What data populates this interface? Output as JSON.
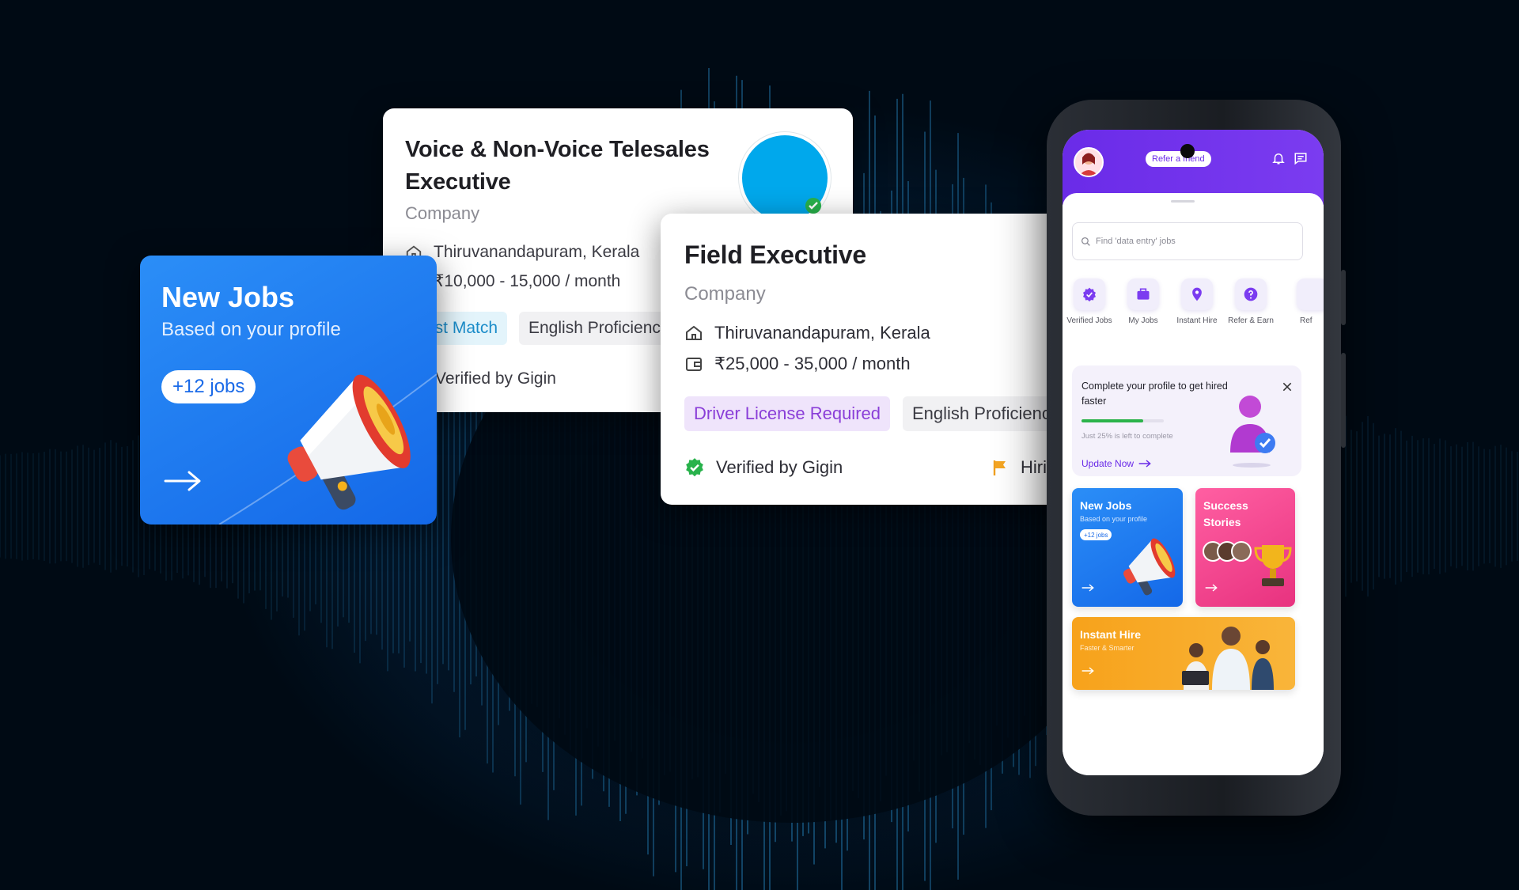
{
  "card_voice": {
    "title": "Voice & Non-Voice Telesales Executive",
    "company": "Company",
    "location": "Thiruvanandapuram, Kerala",
    "salary": "₹10,000 - 15,000 / month",
    "chips": [
      "Best Match",
      "English Proficiency"
    ],
    "verified": "Verified by Gigin",
    "logo_color": "#00a8ec"
  },
  "card_field": {
    "title": "Field Executive",
    "company": "Company",
    "location": "Thiruvanandapuram, Kerala",
    "salary": "₹25,000 - 35,000 / month",
    "chips": [
      "Driver License Required",
      "English Proficiency"
    ],
    "verified": "Verified by Gigin",
    "hiring": "Hiring"
  },
  "new_jobs": {
    "title": "New Jobs",
    "subtitle": "Based on your profile",
    "badge": "+12 jobs",
    "color": "#1f7cf2"
  },
  "app": {
    "refer": "Refer a friend",
    "search_placeholder": "Find 'data entry' jobs",
    "quick_actions": [
      {
        "label": "Verified Jobs",
        "icon": "verified-badge-icon"
      },
      {
        "label": "My Jobs",
        "icon": "briefcase-icon"
      },
      {
        "label": "Instant Hire",
        "icon": "location-pin-icon"
      },
      {
        "label": "Refer & Earn",
        "icon": "question-icon"
      },
      {
        "label": "Ref",
        "icon": "partial-icon"
      }
    ],
    "profile": {
      "text": "Complete your profile to get hired faster",
      "progress": 0.75,
      "hint": "Just 25% is left to complete",
      "cta": "Update Now"
    },
    "tiles": {
      "new_jobs": {
        "title": "New Jobs",
        "subtitle": "Based on your profile",
        "badge": "+12 jobs"
      },
      "success": {
        "title": "Success Stories"
      },
      "instant": {
        "title": "Instant Hire",
        "subtitle": "Faster & Smarter"
      }
    },
    "accent": "#6a2be8"
  }
}
